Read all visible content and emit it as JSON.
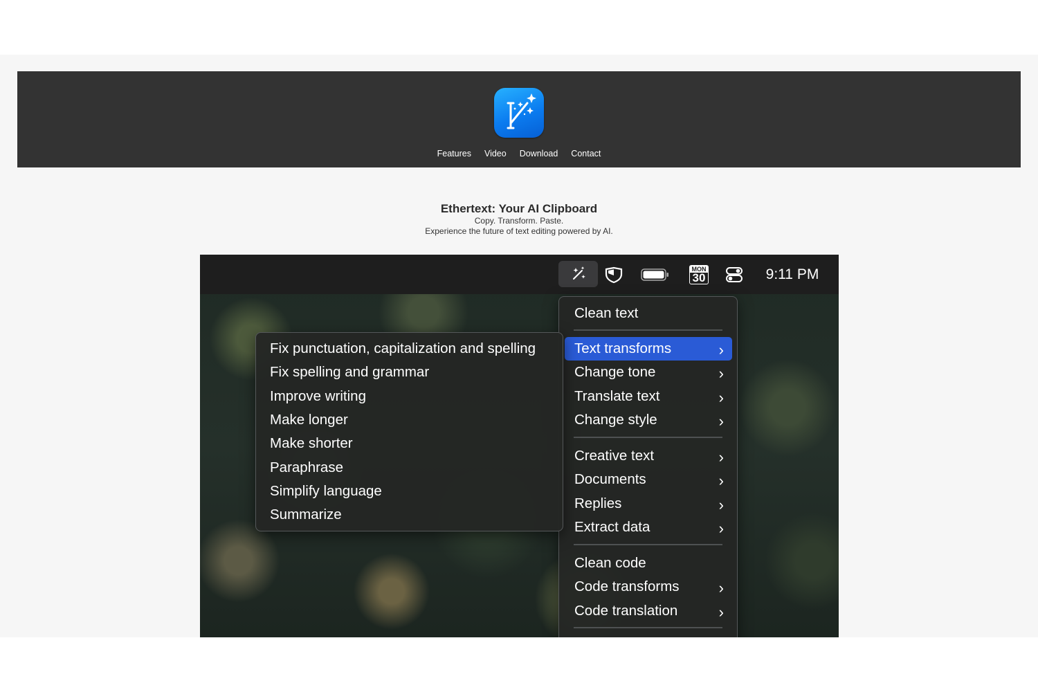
{
  "site": {
    "nav": [
      "Features",
      "Video",
      "Download",
      "Contact"
    ],
    "title": "Ethertext: Your AI Clipboard",
    "tagline": "Copy. Transform. Paste.",
    "description": "Experience the future of text editing powered by AI."
  },
  "menubar": {
    "icons": [
      "magic-wand-icon",
      "shield-icon",
      "battery-icon",
      "calendar-icon",
      "control-center-icon"
    ],
    "calendar_month": "MON",
    "calendar_day": "30",
    "clock": "9:11 PM"
  },
  "main_menu": {
    "items": [
      {
        "label": "Clean text",
        "submenu": false
      },
      {
        "label": "Text transforms",
        "submenu": true,
        "highlighted": true
      },
      {
        "label": "Change tone",
        "submenu": true
      },
      {
        "label": "Translate text",
        "submenu": true
      },
      {
        "label": "Change style",
        "submenu": true
      },
      {
        "label": "Creative text",
        "submenu": true
      },
      {
        "label": "Documents",
        "submenu": true
      },
      {
        "label": "Replies",
        "submenu": true
      },
      {
        "label": "Extract data",
        "submenu": true
      },
      {
        "label": "Clean code",
        "submenu": false
      },
      {
        "label": "Code transforms",
        "submenu": true
      },
      {
        "label": "Code translation",
        "submenu": true
      }
    ],
    "chevron": "›"
  },
  "sub_menu": {
    "items": [
      "Fix punctuation, capitalization and spelling",
      "Fix spelling and grammar",
      "Improve writing",
      "Make longer",
      "Make shorter",
      "Paraphrase",
      "Simplify language",
      "Summarize"
    ]
  },
  "colors": {
    "header_bg": "#333333",
    "page_bg": "#f6f6f6",
    "menubar_bg": "#1e1e1e",
    "highlight": "#2a5bd6"
  }
}
